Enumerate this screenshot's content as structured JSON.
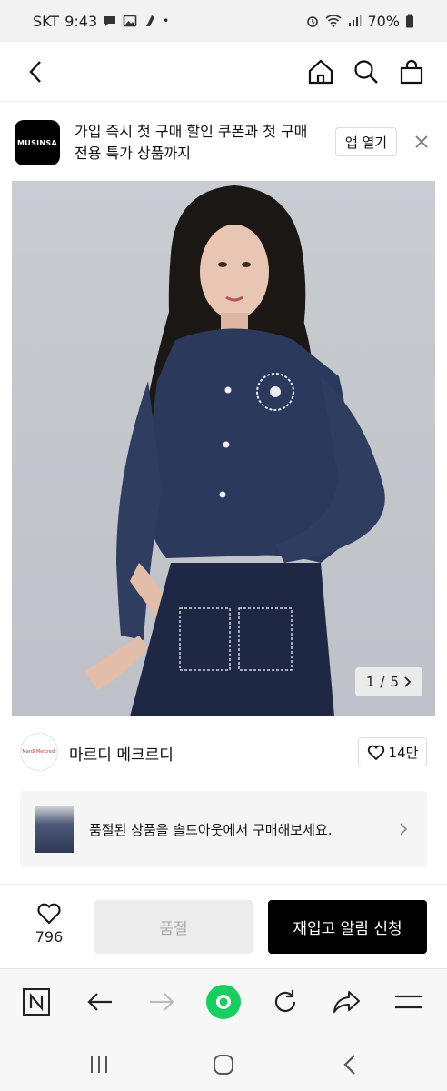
{
  "status_bar": {
    "carrier": "SKT",
    "time": "9:43",
    "notif_icons": [
      "chat-bubble-icon",
      "image-icon",
      "app-icon"
    ],
    "dot": "•",
    "right_icons": [
      "alarm-icon",
      "wifi-icon",
      "signal-icon"
    ],
    "battery": "70%"
  },
  "header": {
    "back_icon": "chevron-left-icon",
    "icons": [
      "home-icon",
      "search-icon",
      "shopping-bag-icon"
    ]
  },
  "app_banner": {
    "logo_text": "MUSINSA",
    "message": "가입 즉시 첫 구매 할인 쿠폰과 첫 구매 전용 특가 상품까지",
    "open_label": "앱 열기",
    "close_icon": "close-icon"
  },
  "product_image": {
    "counter_current": "1",
    "counter_sep": "/",
    "counter_total": "5"
  },
  "brand": {
    "logo_text": "Mardi Mercredi",
    "name": "마르디 메크르디",
    "like_count": "14만"
  },
  "soldout_card": {
    "message": "품절된 상품을 솔드아웃에서 구매해보세요."
  },
  "action_bar": {
    "wish_count": "796",
    "soldout_label": "품절",
    "restock_label": "재입고 알림 신청",
    "colors": {
      "primary": "#000000",
      "disabled_bg": "#ececec",
      "disabled_text": "#aaaaaa"
    }
  },
  "browser_bar": {
    "items": [
      "naver-icon",
      "back-arrow-icon",
      "forward-arrow-icon",
      "green-dot-icon",
      "refresh-icon",
      "share-icon",
      "menu-icon"
    ],
    "accent": "#19ce60"
  },
  "system_nav": {
    "items": [
      "recent-apps-icon",
      "home-circle-icon",
      "back-chevron-icon"
    ]
  }
}
